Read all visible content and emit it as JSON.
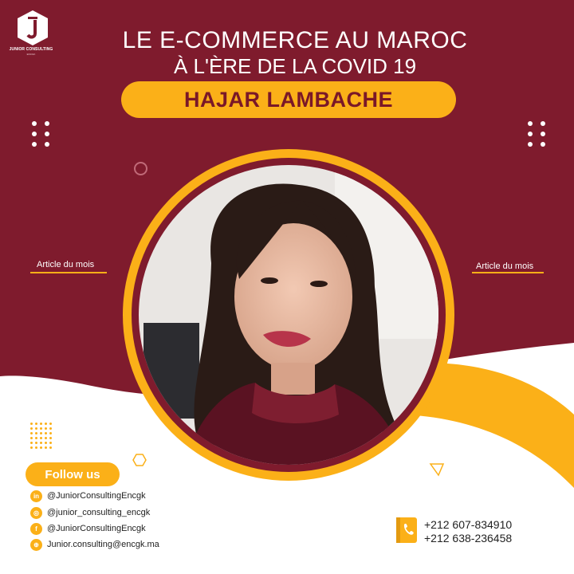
{
  "brand": {
    "logo_letter": "J",
    "name": "JUNIOR CONSULTING",
    "sub": "ENCGK"
  },
  "title": {
    "line1": "LE E-COMMERCE AU MAROC",
    "line2": "À L'ÈRE DE LA COVID 19"
  },
  "author": "HAJAR LAMBACHE",
  "labels": {
    "article_left": "Article du mois",
    "article_right": "Article du mois"
  },
  "follow": {
    "label": "Follow us",
    "items": [
      {
        "icon": "linkedin-icon",
        "glyph": "in",
        "text": "@JuniorConsultingEncgk"
      },
      {
        "icon": "instagram-icon",
        "glyph": "◎",
        "text": "@junior_consulting_encgk"
      },
      {
        "icon": "facebook-icon",
        "glyph": "f",
        "text": "@JuniorConsultingEncgk"
      },
      {
        "icon": "globe-icon",
        "glyph": "⊕",
        "text": "Junior.consulting@encgk.ma"
      }
    ]
  },
  "contact": {
    "phones": [
      "+212 607-834910",
      "+212 638-236458"
    ]
  },
  "colors": {
    "maroon": "#7f1b2d",
    "yellow": "#fbb018",
    "white": "#ffffff",
    "text": "#222222"
  }
}
